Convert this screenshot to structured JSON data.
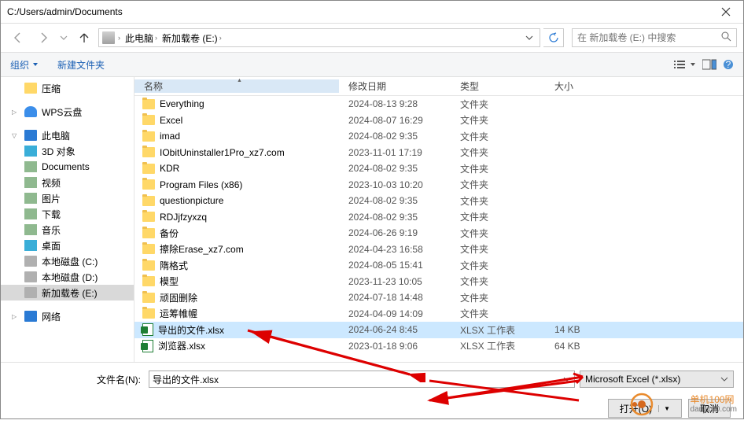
{
  "title": "C:/Users/admin/Documents",
  "path": {
    "pc": "此电脑",
    "vol": "新加载卷 (E:)"
  },
  "search_placeholder": "在 新加载卷 (E:) 中搜索",
  "toolbar": {
    "organize": "组织",
    "newfolder": "新建文件夹"
  },
  "cols": {
    "name": "名称",
    "date": "修改日期",
    "type": "类型",
    "size": "大小"
  },
  "sidebar": {
    "compress": "压缩",
    "wps": "WPS云盘",
    "pc": "此电脑",
    "d3": "3D 对象",
    "docs": "Documents",
    "video": "视频",
    "pic": "图片",
    "down": "下载",
    "music": "音乐",
    "desk": "桌面",
    "diskc": "本地磁盘 (C:)",
    "diskd": "本地磁盘 (D:)",
    "vole": "新加载卷 (E:)",
    "net": "网络"
  },
  "rows": [
    {
      "n": "Everything",
      "d": "2024-08-13 9:28",
      "t": "文件夹",
      "s": "",
      "k": "folder"
    },
    {
      "n": "Excel",
      "d": "2024-08-07 16:29",
      "t": "文件夹",
      "s": "",
      "k": "folder"
    },
    {
      "n": "imad",
      "d": "2024-08-02 9:35",
      "t": "文件夹",
      "s": "",
      "k": "folder"
    },
    {
      "n": "IObitUninstaller1Pro_xz7.com",
      "d": "2023-11-01 17:19",
      "t": "文件夹",
      "s": "",
      "k": "folder"
    },
    {
      "n": "KDR",
      "d": "2024-08-02 9:35",
      "t": "文件夹",
      "s": "",
      "k": "folder"
    },
    {
      "n": "Program Files (x86)",
      "d": "2023-10-03 10:20",
      "t": "文件夹",
      "s": "",
      "k": "folder"
    },
    {
      "n": "questionpicture",
      "d": "2024-08-02 9:35",
      "t": "文件夹",
      "s": "",
      "k": "folder"
    },
    {
      "n": "RDJjfzyxzq",
      "d": "2024-08-02 9:35",
      "t": "文件夹",
      "s": "",
      "k": "folder"
    },
    {
      "n": "备份",
      "d": "2024-06-26 9:19",
      "t": "文件夹",
      "s": "",
      "k": "folder"
    },
    {
      "n": "擦除Erase_xz7.com",
      "d": "2024-04-23 16:58",
      "t": "文件夹",
      "s": "",
      "k": "folder"
    },
    {
      "n": "隋格式",
      "d": "2024-08-05 15:41",
      "t": "文件夹",
      "s": "",
      "k": "folder"
    },
    {
      "n": "模型",
      "d": "2023-11-23 10:05",
      "t": "文件夹",
      "s": "",
      "k": "folder"
    },
    {
      "n": "顽固删除",
      "d": "2024-07-18 14:48",
      "t": "文件夹",
      "s": "",
      "k": "folder"
    },
    {
      "n": "运筹帷幄",
      "d": "2024-04-09 14:09",
      "t": "文件夹",
      "s": "",
      "k": "folder"
    },
    {
      "n": "导出的文件.xlsx",
      "d": "2024-06-24 8:45",
      "t": "XLSX 工作表",
      "s": "14 KB",
      "k": "xlsx",
      "sel": true
    },
    {
      "n": "浏览器.xlsx",
      "d": "2023-01-18 9:06",
      "t": "XLSX 工作表",
      "s": "64 KB",
      "k": "xlsx"
    }
  ],
  "filename": {
    "label": "文件名(N):",
    "value": "导出的文件.xlsx"
  },
  "filter": "Microsoft Excel (*.xlsx)",
  "open": "打开(O)",
  "cancel": "取消",
  "wm1": "单机100网",
  "wm2": "danji100.com"
}
